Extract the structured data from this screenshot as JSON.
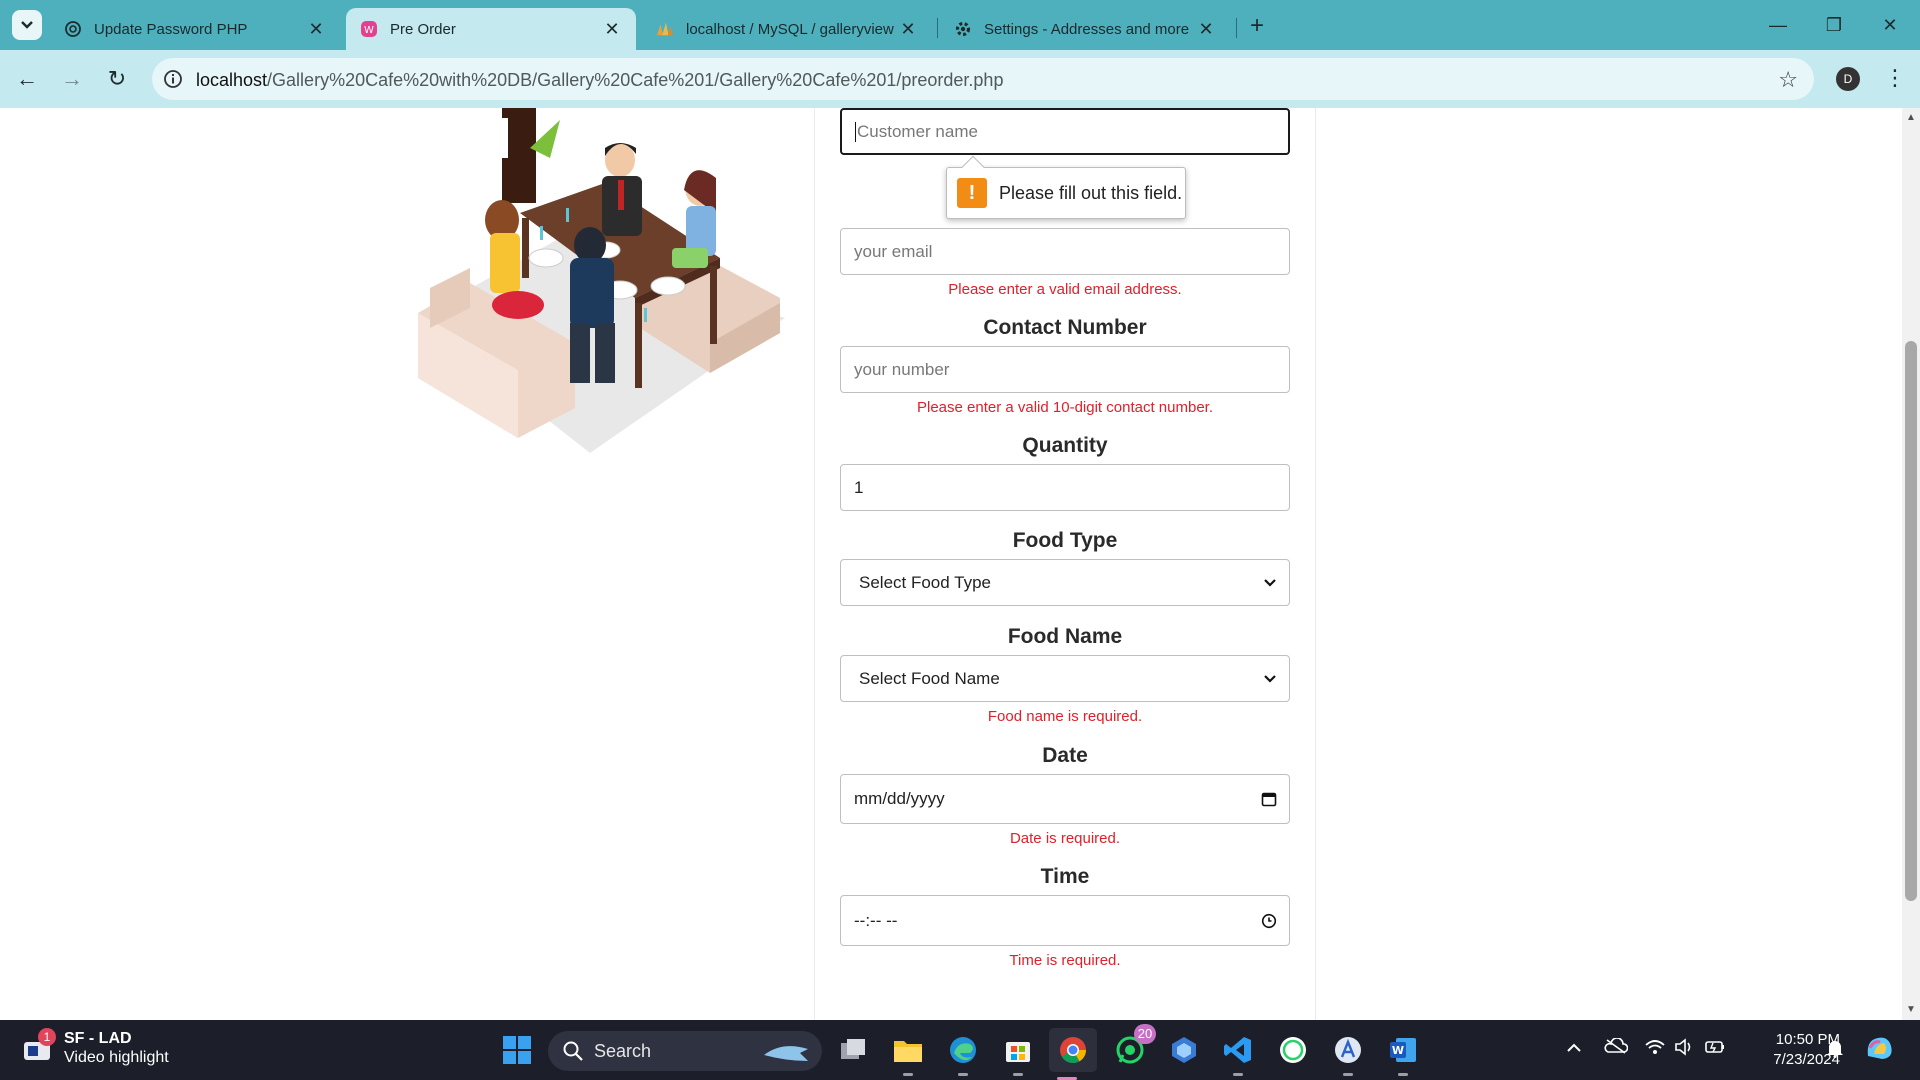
{
  "browser": {
    "tabs": [
      {
        "title": "Update Password PHP",
        "icon": "chatgpt-icon",
        "active": false
      },
      {
        "title": "Pre Order",
        "icon": "app-favicon-icon",
        "active": true
      },
      {
        "title": "localhost / MySQL / galleryview",
        "icon": "phpmyadmin-icon",
        "active": false
      },
      {
        "title": "Settings - Addresses and more",
        "icon": "gear-icon",
        "active": false
      }
    ],
    "url_host": "localhost",
    "url_path": "/Gallery%20Cafe%20with%20DB/Gallery%20Cafe%201/Gallery%20Cafe%201/preorder.php",
    "profile_initial": "D"
  },
  "form": {
    "customer_name": {
      "placeholder": "Customer name",
      "value": ""
    },
    "tooltip": "Please fill out this field.",
    "email": {
      "placeholder": "your email",
      "error": "Please enter a valid email address."
    },
    "contact": {
      "label": "Contact Number",
      "placeholder": "your number",
      "error": "Please enter a valid 10-digit contact number."
    },
    "quantity": {
      "label": "Quantity",
      "value": "1"
    },
    "food_type": {
      "label": "Food Type",
      "selected": "Select Food Type"
    },
    "food_name": {
      "label": "Food Name",
      "selected": "Select Food Name",
      "error": "Food name is required."
    },
    "date": {
      "label": "Date",
      "value": "mm/dd/yyyy",
      "error": "Date is required."
    },
    "time": {
      "label": "Time",
      "value": "--:-- --",
      "error": "Time is required."
    }
  },
  "taskbar": {
    "widget_title": "SF - LAD",
    "widget_sub": "Video highlight",
    "widget_badge": "1",
    "search_label": "Search",
    "whatsapp_badge": "20",
    "time": "10:50 PM",
    "date": "7/23/2024"
  },
  "colors": {
    "tabstrip": "#4fb0bd",
    "toolbar": "#c4e9ee",
    "error": "#e0202b",
    "warning": "#f28c14"
  }
}
